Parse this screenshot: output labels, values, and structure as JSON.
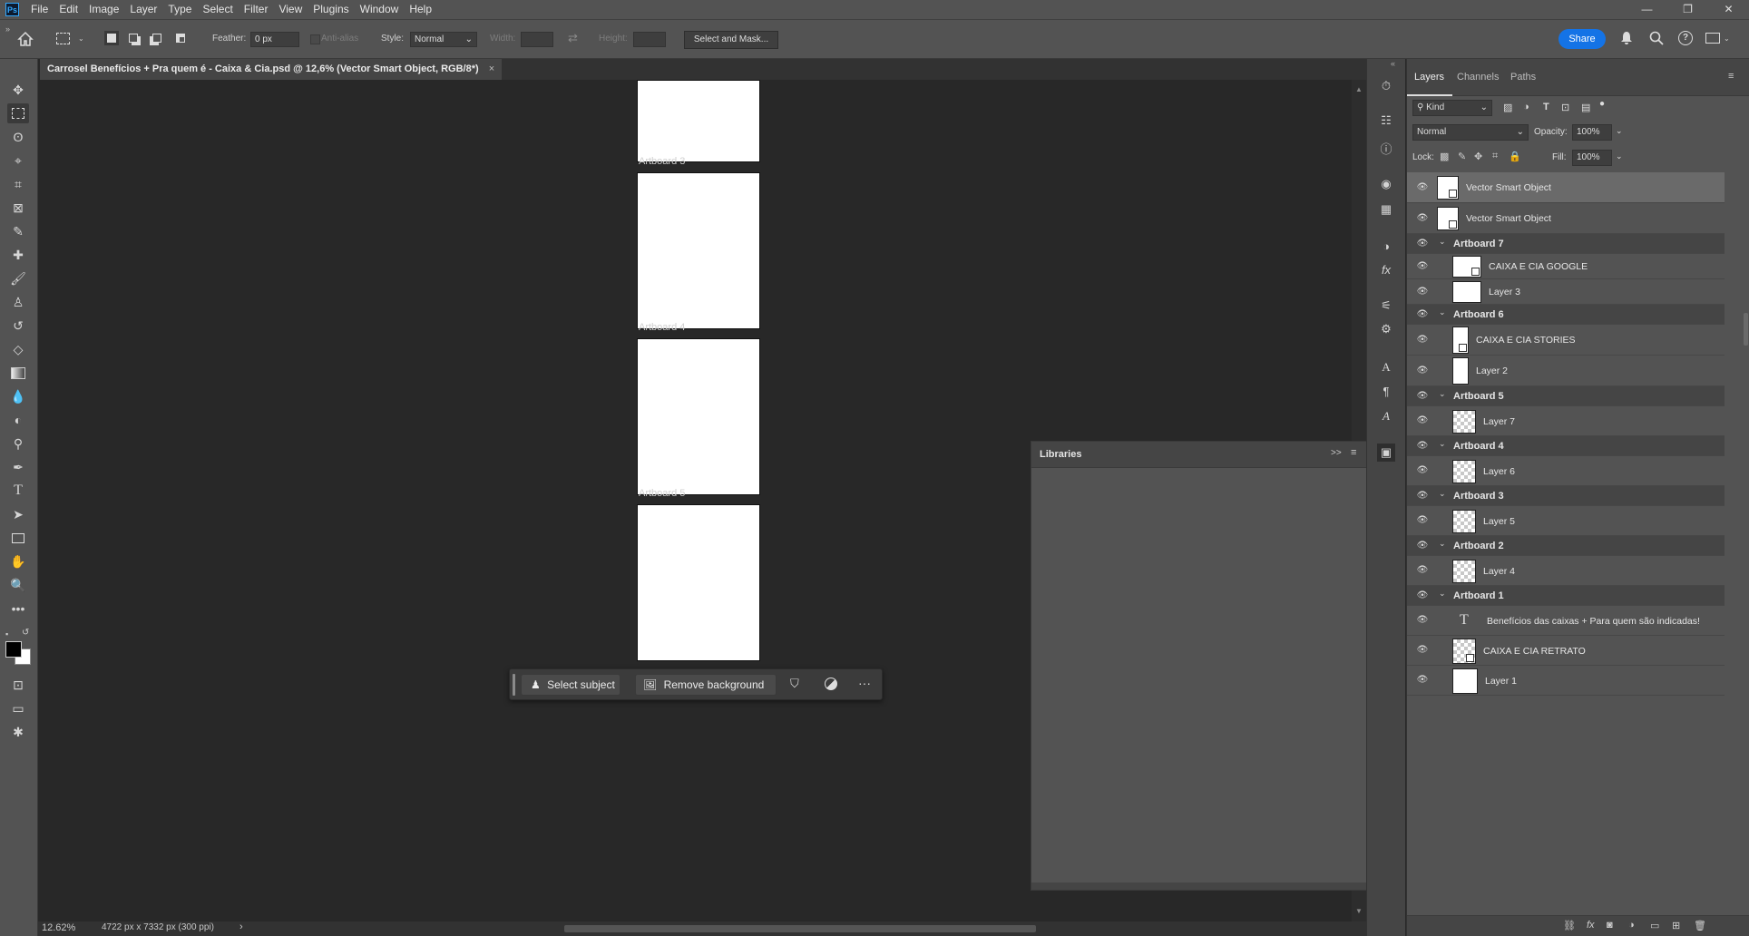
{
  "app": {
    "logo": "Ps"
  },
  "menu": [
    "File",
    "Edit",
    "Image",
    "Layer",
    "Type",
    "Select",
    "Filter",
    "View",
    "Plugins",
    "Window",
    "Help"
  ],
  "window_controls": {
    "minimize": "—",
    "restore": "❐",
    "close": "✕"
  },
  "options": {
    "feather_label": "Feather:",
    "feather_value": "0 px",
    "antialias_label": "Anti-alias",
    "style_label": "Style:",
    "style_value": "Normal",
    "width_label": "Width:",
    "height_label": "Height:",
    "select_and_mask": "Select and Mask...",
    "share": "Share"
  },
  "document_tab": {
    "title": "Carrosel Benefícios + Pra quem é - Caixa & Cia.psd @ 12,6% (Vector Smart Object, RGB/8*)",
    "close": "×"
  },
  "artboard_labels": [
    "Artboard 3",
    "Artboard 4",
    "Artboard 5"
  ],
  "context_bar": {
    "select_subject": "Select subject",
    "remove_background": "Remove background",
    "more": "···"
  },
  "status": {
    "zoom": "12.62%",
    "doc_info": "4722 px x 7332 px (300 ppi)",
    "arrow": "›"
  },
  "libraries": {
    "title": "Libraries",
    "collapse": ">>"
  },
  "layers_panel": {
    "tabs": [
      "Layers",
      "Channels",
      "Paths"
    ],
    "filter_kind": "Kind",
    "blend_mode": "Normal",
    "opacity_label": "Opacity:",
    "opacity_value": "100%",
    "lock_label": "Lock:",
    "fill_label": "Fill:",
    "fill_value": "100%",
    "layers": [
      {
        "name": "Vector Smart Object",
        "type": "so",
        "selected": true
      },
      {
        "name": "Vector Smart Object",
        "type": "so"
      },
      {
        "name": "Artboard 7",
        "type": "group"
      },
      {
        "name": "CAIXA E CIA GOOGLE",
        "type": "so-wide",
        "indent": true
      },
      {
        "name": "Layer 3",
        "type": "white-wide",
        "indent": true
      },
      {
        "name": "Artboard 6",
        "type": "group"
      },
      {
        "name": "CAIXA E CIA STORIES",
        "type": "so-tall",
        "indent": true
      },
      {
        "name": "Layer 2",
        "type": "white-tall",
        "indent": true
      },
      {
        "name": "Artboard 5",
        "type": "group"
      },
      {
        "name": "Layer 7",
        "type": "checker",
        "indent": true
      },
      {
        "name": "Artboard 4",
        "type": "group"
      },
      {
        "name": "Layer 6",
        "type": "checker",
        "indent": true
      },
      {
        "name": "Artboard 3",
        "type": "group"
      },
      {
        "name": "Layer 5",
        "type": "checker",
        "indent": true
      },
      {
        "name": "Artboard 2",
        "type": "group"
      },
      {
        "name": "Layer 4",
        "type": "checker",
        "indent": true
      },
      {
        "name": "Artboard 1",
        "type": "group"
      },
      {
        "name": "Benefícios das caixas + Para quem  são indicadas!",
        "type": "text",
        "indent": true
      },
      {
        "name": "CAIXA E CIA RETRATO",
        "type": "so-sq",
        "indent": true
      },
      {
        "name": "Layer 1",
        "type": "white-sq",
        "indent": true
      }
    ]
  }
}
